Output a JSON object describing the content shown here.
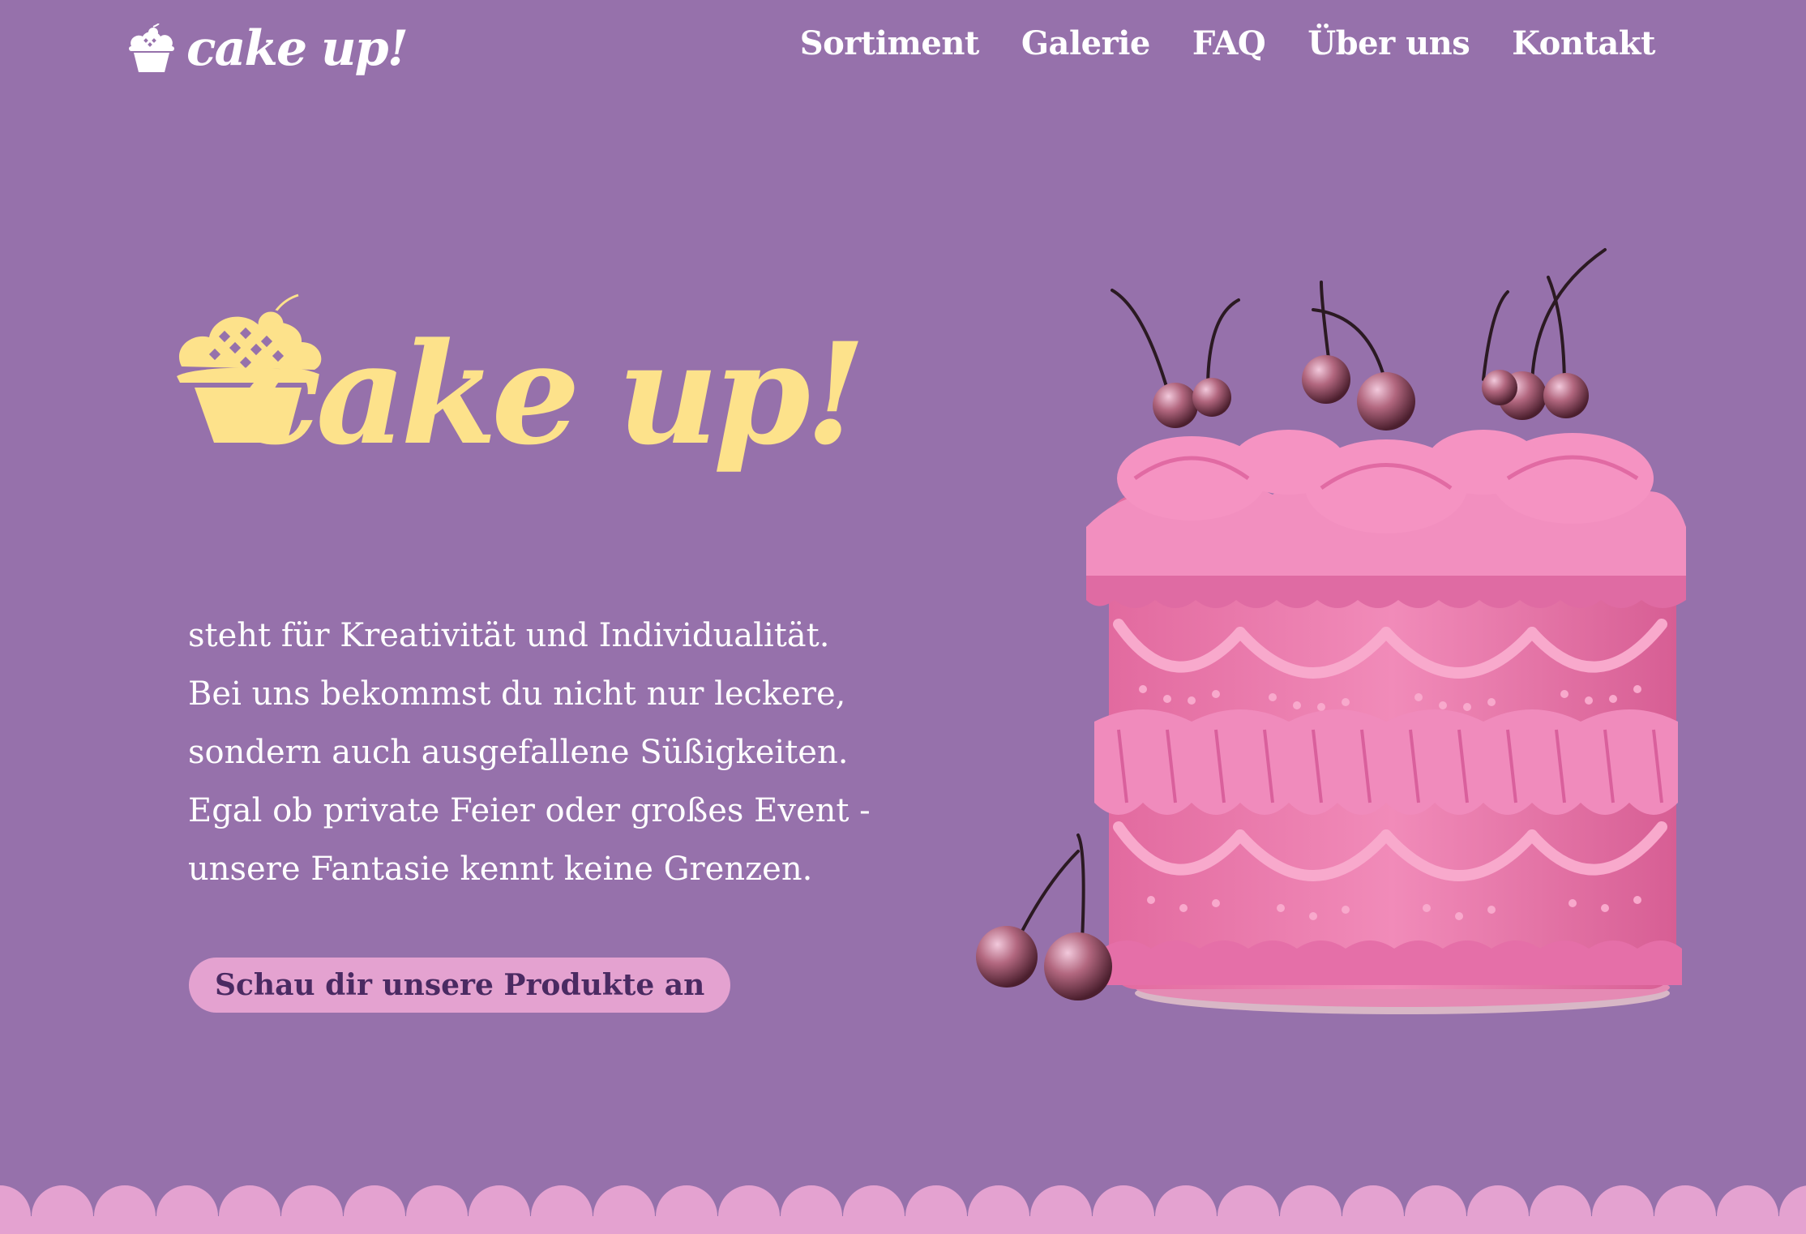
{
  "brand": {
    "name": "cake up!",
    "icon": "cupcake-icon",
    "colors": {
      "background": "#9671ab",
      "logo_yellow": "#fde28b",
      "button_pink": "#e4a2d0",
      "button_text": "#4a2a62",
      "cake_pink": "#ec7fb0"
    }
  },
  "nav": {
    "items": [
      {
        "label": "Sortiment"
      },
      {
        "label": "Galerie"
      },
      {
        "label": "FAQ"
      },
      {
        "label": "Über uns"
      },
      {
        "label": "Kontakt"
      }
    ]
  },
  "hero": {
    "logo_text": "cake up!",
    "text_lines": [
      "steht für Kreativität und Individualität.",
      "Bei uns bekommst du nicht nur leckere,",
      "sondern auch ausgefallene Süßigkeiten.",
      "Egal ob private Feier oder großes Event -",
      "unsere Fantasie kennt keine Grenzen."
    ],
    "cta_label": "Schau dir unsere Produkte an",
    "image": "pink-cherry-cake-photo"
  }
}
